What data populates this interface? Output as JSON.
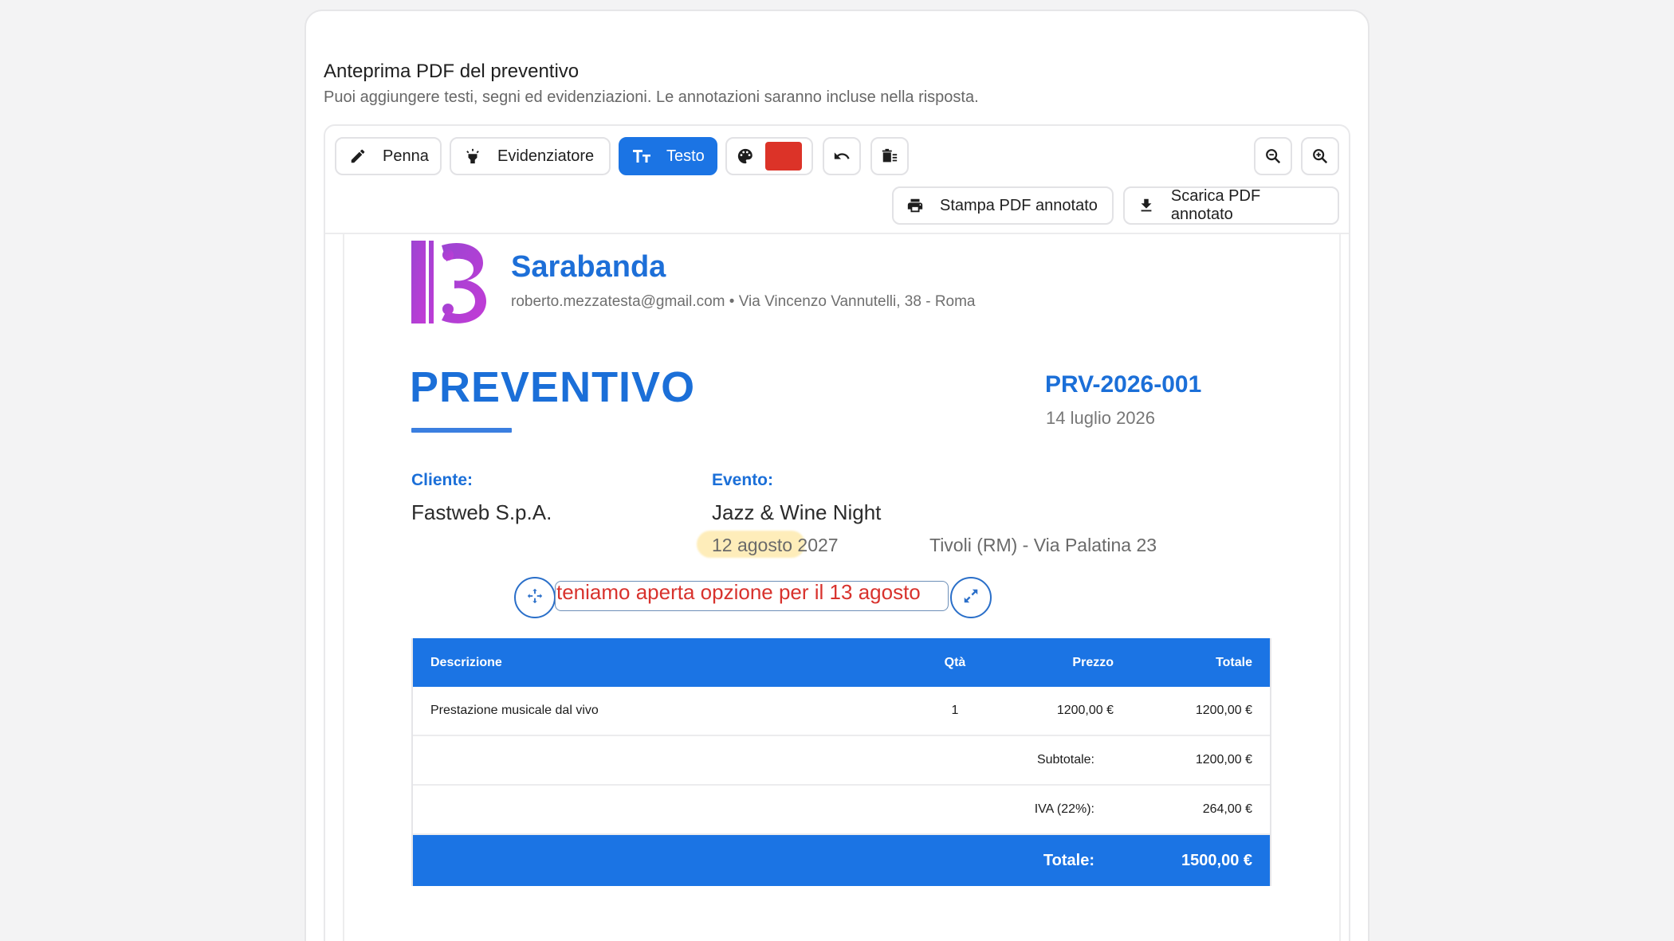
{
  "panel": {
    "title": "Anteprima PDF del preventivo",
    "subtitle": "Puoi aggiungere testi, segni ed evidenziazioni. Le annotazioni saranno incluse nella risposta."
  },
  "toolbar": {
    "pen_label": "Penna",
    "highlighter_label": "Evidenziatore",
    "text_label": "Testo",
    "print_label": "Stampa PDF annotato",
    "download_label": "Scarica PDF annotato",
    "selected_color": "#dc3328",
    "active_tool": "text"
  },
  "document": {
    "brand_name": "Sarabanda",
    "brand_contact": "roberto.mezzatesta@gmail.com • Via Vincenzo Vannutelli, 38 - Roma",
    "doc_type": "PREVENTIVO",
    "doc_number": "PRV-2026-001",
    "doc_date": "14 luglio 2026",
    "client_label": "Cliente:",
    "client_name": "Fastweb S.p.A.",
    "event_label": "Evento:",
    "event_name": "Jazz & Wine Night",
    "event_date": "12 agosto 2027",
    "event_location": "Tivoli (RM) - Via Palatina 23",
    "brand_color": "#1b6fd8"
  },
  "annotation": {
    "text": "teniamo aperta opzione per il 13 agosto",
    "color": "#d8322d"
  },
  "table": {
    "headers": {
      "description": "Descrizione",
      "qty": "Qtà",
      "price": "Prezzo",
      "total": "Totale"
    },
    "rows": [
      {
        "description": "Prestazione musicale dal vivo",
        "qty": "1",
        "price": "1200,00 €",
        "total": "1200,00 €"
      }
    ],
    "subtotal_label": "Subtotale:",
    "subtotal_value": "1200,00 €",
    "vat_label": "IVA (22%):",
    "vat_value": "264,00 €",
    "grand_total_label": "Totale:",
    "grand_total_value": "1500,00 €"
  }
}
